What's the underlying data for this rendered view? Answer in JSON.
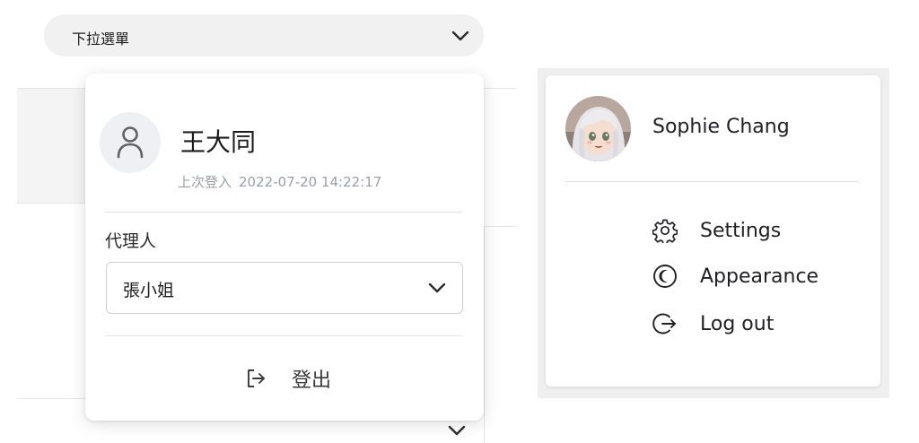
{
  "dropdown": {
    "trigger_label": "下拉選單"
  },
  "user_card": {
    "name": "王大同",
    "last_login_label": "上次登入",
    "last_login_time": "2022-07-20 14:22:17",
    "proxy_label": "代理人",
    "proxy_selected": "張小姐",
    "logout_label": "登出"
  },
  "profile_menu": {
    "name": "Sophie Chang",
    "items": [
      {
        "label": "Settings",
        "icon": "gear-icon"
      },
      {
        "label": "Appearance",
        "icon": "moon-icon"
      },
      {
        "label": "Log out",
        "icon": "logout-icon"
      }
    ]
  },
  "colors": {
    "trigger_bg": "#f1f1f2",
    "muted_text": "#9aa0a6",
    "border": "#d0d0d0"
  }
}
